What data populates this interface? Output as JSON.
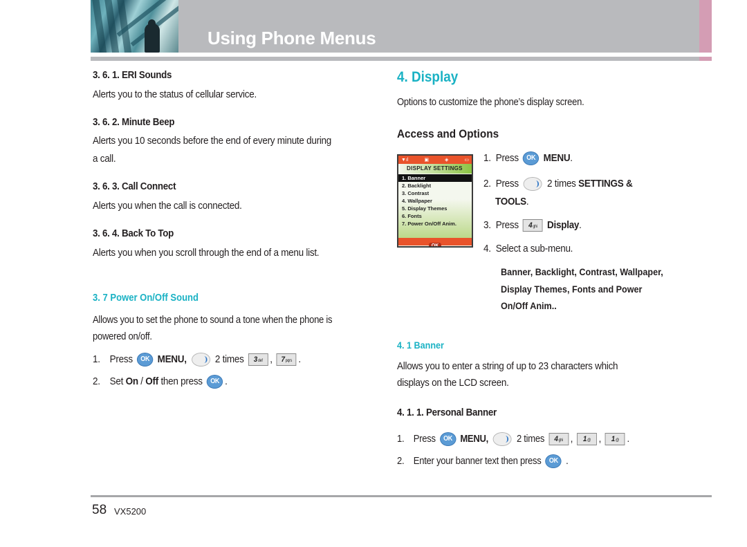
{
  "header": {
    "title": "Using Phone Menus",
    "accent_color": "#d49db4",
    "bar_color": "#b9babd"
  },
  "left": {
    "sections": [
      {
        "heading": "3. 6. 1. ERI Sounds",
        "text": "Alerts you to the status of cellular service."
      },
      {
        "heading": "3. 6. 2. Minute Beep",
        "text_line1": "Alerts you 10 seconds before the end of every minute during",
        "text_line2": "a call."
      },
      {
        "heading": "3. 6. 3. Call Connect",
        "text": "Alerts you when the call is connected."
      },
      {
        "heading": "3. 6. 4. Back To Top",
        "text": "Alerts you when you scroll through the end of a menu list."
      }
    ],
    "power": {
      "heading": "3. 7 Power On/Off Sound",
      "text_line1": "Allows you to set the phone to sound a tone when the phone is",
      "text_line2": "powered on/off.",
      "steps": [
        {
          "num": "1.",
          "press": "Press",
          "ok_key": "OK",
          "menu": "MENU,",
          "times": "2 times",
          "key1": "3",
          "key1_sub": "def",
          "comma": ",",
          "key2": "7",
          "key2_sub": "pqrs",
          "end": "."
        },
        {
          "num": "2.",
          "set": "Set",
          "on": "On",
          "slash": " / ",
          "off": "Off",
          "then": "then press",
          "ok_key": "OK",
          "end": "."
        }
      ]
    }
  },
  "right": {
    "title": "4. Display",
    "intro": "Options to customize the phone’s display screen.",
    "access_heading": "Access and Options",
    "phone_screen": {
      "status_icons": [
        "signal-icon",
        "message-icon",
        "vibrate-icon",
        "battery-icon"
      ],
      "title": "DISPLAY SETTINGS",
      "items": [
        "1. Banner",
        "2. Backlight",
        "3. Contrast",
        "4. Wallpaper",
        "5. Display Themes",
        "6. Fonts",
        "7. Power On/Off Anim."
      ],
      "selected_index": 0,
      "softkey": "OK"
    },
    "steps": [
      {
        "num": "1.",
        "press": "Press",
        "ok_key": "OK",
        "bold": "MENU",
        "end": "."
      },
      {
        "num": "2.",
        "press": "Press",
        "times": "2 times",
        "bold": "SETTINGS &",
        "bold2": "TOOLS",
        "end": "."
      },
      {
        "num": "3.",
        "press": "Press",
        "key": "4",
        "key_sub": "ghi",
        "bold": "Display",
        "end": "."
      },
      {
        "num": "4.",
        "text": "Select a sub-menu."
      }
    ],
    "submenu_list": [
      "Banner, Backlight, Contrast, Wallpaper,",
      "Display Themes, Fonts and Power",
      "On/Off Anim.."
    ],
    "banner": {
      "heading": "4. 1 Banner",
      "text_line1": "Allows you to enter a string of up to 23 characters which",
      "text_line2": "displays on the LCD screen.",
      "sub_heading": "4. 1. 1. Personal Banner",
      "steps": [
        {
          "num": "1.",
          "press": "Press",
          "ok_key": "OK",
          "menu": "MENU,",
          "times": "2 times",
          "key1": "4",
          "key1_sub": "ghi",
          "key2": "1",
          "key2_sub": "@",
          "key3": "1",
          "key3_sub": "@",
          "comma": ",",
          "end": "."
        },
        {
          "num": "2.",
          "text": "Enter your banner text then press",
          "ok_key": "OK",
          "end": "."
        }
      ]
    }
  },
  "footer": {
    "page_number": "58",
    "model": "VX5200"
  }
}
